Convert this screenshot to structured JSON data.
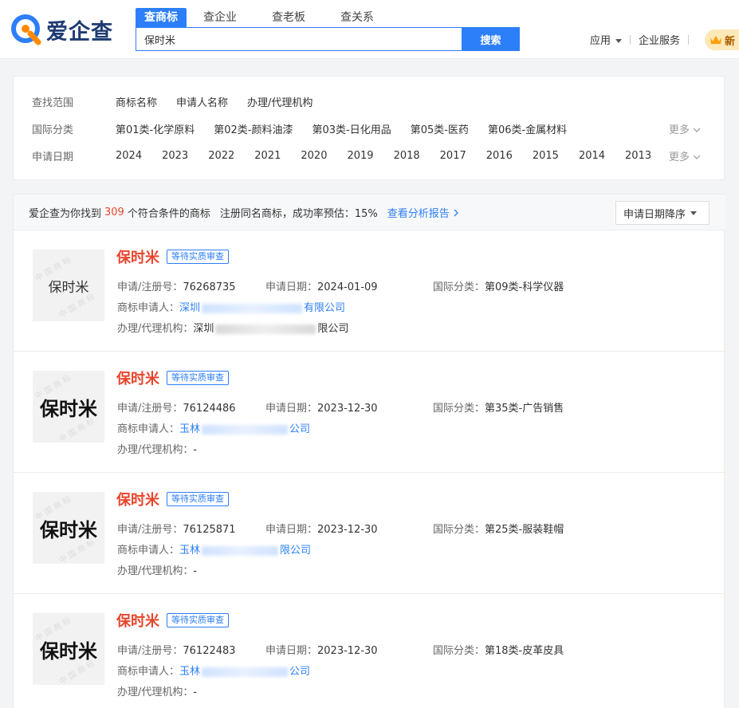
{
  "header": {
    "logo_text": "爱企查",
    "tabs": [
      "查商标",
      "查企业",
      "查老板",
      "查关系"
    ],
    "search_value": "保时米",
    "search_button": "搜索",
    "apps": "应用",
    "enterprise": "企业服务",
    "vip": "新"
  },
  "filters": {
    "scope": {
      "label": "查找范围",
      "options": [
        "商标名称",
        "申请人名称",
        "办理/代理机构"
      ]
    },
    "intl": {
      "label": "国际分类",
      "options": [
        "第01类-化学原料",
        "第02类-颜料油漆",
        "第03类-日化用品",
        "第05类-医药",
        "第06类-金属材料"
      ],
      "more": "更多"
    },
    "date": {
      "label": "申请日期",
      "options": [
        "2024",
        "2023",
        "2022",
        "2021",
        "2020",
        "2019",
        "2018",
        "2017",
        "2016",
        "2015",
        "2014",
        "2013"
      ],
      "more": "更多"
    }
  },
  "summary": {
    "prefix": "爱企查为你找到",
    "count": "309",
    "suffix": "个符合条件的商标",
    "rate": "注册同名商标，成功率预估：15%",
    "report_link": "查看分析报告",
    "sort": "申请日期降序"
  },
  "labels": {
    "reg_no": "申请/注册号：",
    "apply_date": "申请日期：",
    "intl_class": "国际分类：",
    "applicant": "商标申请人：",
    "agency": "办理/代理机构："
  },
  "results": [
    {
      "name": "保时米",
      "status": "等待实质审查",
      "thumb_text": "保时米",
      "reg_no": "76268735",
      "date": "2024-01-09",
      "class": "第09类-科学仪器",
      "applicant_a": "深圳",
      "applicant_b": "有限公司",
      "agency_a": "深圳",
      "agency_b": "限公司"
    },
    {
      "name": "保时米",
      "status": "等待实质审查",
      "thumb_text": "保时米",
      "reg_no": "76124486",
      "date": "2023-12-30",
      "class": "第35类-广告销售",
      "applicant_a": "玉林",
      "applicant_b": "公司",
      "agency_a": "-",
      "agency_b": ""
    },
    {
      "name": "保时米",
      "status": "等待实质审查",
      "thumb_text": "保时米",
      "reg_no": "76125871",
      "date": "2023-12-30",
      "class": "第25类-服装鞋帽",
      "applicant_a": "玉林",
      "applicant_b": "限公司",
      "agency_a": "-",
      "agency_b": ""
    },
    {
      "name": "保时米",
      "status": "等待实质审查",
      "thumb_text": "保时米",
      "reg_no": "76122483",
      "date": "2023-12-30",
      "class": "第18类-皮革皮具",
      "applicant_a": "玉林",
      "applicant_b": "公司",
      "agency_a": "-",
      "agency_b": ""
    }
  ],
  "colors": {
    "accent": "#2d7ff9",
    "brand_red": "#e8452c",
    "logo_orange": "#ff8a00"
  }
}
